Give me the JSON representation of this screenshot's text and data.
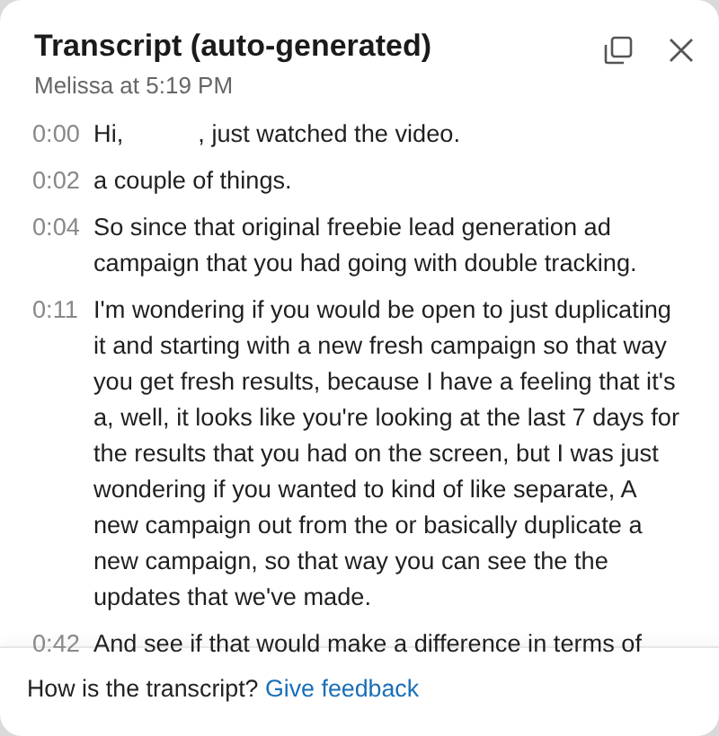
{
  "header": {
    "title": "Transcript (auto-generated)",
    "subtitle": "Melissa at 5:19 PM"
  },
  "segments": [
    {
      "time": "0:00",
      "text": "Hi,           , just watched the video."
    },
    {
      "time": "0:02",
      "text": "a couple of things."
    },
    {
      "time": "0:04",
      "text": "So since that original freebie lead generation ad campaign that you had going with double tracking."
    },
    {
      "time": "0:11",
      "text": "I'm wondering if you would be open to just duplicating it and starting with a new fresh campaign so that way you get fresh results, because I have a feeling that it's a, well, it looks like you're looking at the last 7 days for the results that you had on the screen, but I was just wondering if you wanted to kind of like separate, A new campaign out from the or basically duplicate a new campaign, so that way you can see the the updates that we've made."
    },
    {
      "time": "0:42",
      "text": "And see if that would make a difference in terms of"
    }
  ],
  "footer": {
    "prompt": "How is the transcript?",
    "link": "Give feedback"
  }
}
